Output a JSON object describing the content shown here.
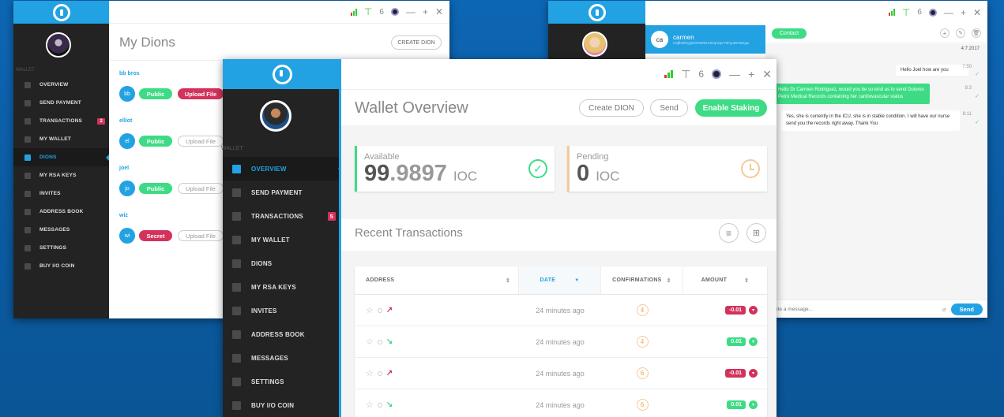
{
  "colors": {
    "brand": "#22a2e3",
    "green": "#3ddc84",
    "red": "#d3325b",
    "orange": "#f5a04a",
    "sidebar": "#232323"
  },
  "w1": {
    "title": "My Dions",
    "create_label": "CREATE DION",
    "section_label": "WALLET",
    "nav": [
      {
        "label": "OVERVIEW",
        "icon": "home-icon"
      },
      {
        "label": "SEND PAYMENT",
        "icon": "send-icon"
      },
      {
        "label": "TRANSACTIONS",
        "icon": "transfer-icon",
        "badge": "2"
      },
      {
        "label": "MY WALLET",
        "icon": "wallet-icon"
      },
      {
        "label": "DIONS",
        "icon": "folder-icon"
      },
      {
        "label": "MY RSA KEYS",
        "icon": "key-icon"
      },
      {
        "label": "INVITES",
        "icon": "invite-icon"
      },
      {
        "label": "ADDRESS BOOK",
        "icon": "star-icon"
      },
      {
        "label": "MESSAGES",
        "icon": "chat-icon"
      },
      {
        "label": "SETTINGS",
        "icon": "settings-icon"
      },
      {
        "label": "BUY I/O COIN",
        "icon": "coin-icon"
      }
    ],
    "dions": [
      {
        "name": "bb bros",
        "initials": "bb",
        "status": "Public",
        "action": "Upload File",
        "action_active": true
      },
      {
        "name": "elliot",
        "initials": "el",
        "status": "Public",
        "action": "Upload File",
        "action_active": false
      },
      {
        "name": "joel",
        "initials": "jo",
        "status": "Public",
        "action": "Upload File",
        "action_active": false
      },
      {
        "name": "wiz",
        "initials": "wi",
        "status": "Secret",
        "action": "Upload File",
        "action_active": false
      }
    ]
  },
  "w2": {
    "title": "Wallet Overview",
    "create_label": "Create DION",
    "send_label": "Send",
    "staking_label": "Enable Staking",
    "section_label": "WALLET",
    "nav": [
      {
        "label": "OVERVIEW",
        "icon": "home-icon"
      },
      {
        "label": "SEND PAYMENT",
        "icon": "send-icon"
      },
      {
        "label": "TRANSACTIONS",
        "icon": "transfer-icon",
        "badge": "5"
      },
      {
        "label": "MY WALLET",
        "icon": "wallet-icon"
      },
      {
        "label": "DIONS",
        "icon": "folder-icon"
      },
      {
        "label": "MY RSA KEYS",
        "icon": "key-icon"
      },
      {
        "label": "INVITES",
        "icon": "invite-icon"
      },
      {
        "label": "ADDRESS BOOK",
        "icon": "star-icon"
      },
      {
        "label": "MESSAGES",
        "icon": "chat-icon"
      },
      {
        "label": "SETTINGS",
        "icon": "settings-icon"
      },
      {
        "label": "BUY I/O COIN",
        "icon": "coin-icon"
      }
    ],
    "available": {
      "label": "Available",
      "int": "99",
      "dec": ".9897",
      "unit": "IOC"
    },
    "pending": {
      "label": "Pending",
      "int": "0",
      "unit": "IOC"
    },
    "recent_title": "Recent Transactions",
    "columns": [
      "ADDRESS",
      "DATE",
      "CONFIRMATIONS",
      "AMOUNT"
    ],
    "rows": [
      {
        "date": "24 minutes ago",
        "conf": "4",
        "amount": "-0.01",
        "dir": "out"
      },
      {
        "date": "24 minutes ago",
        "conf": "4",
        "amount": "0.01",
        "dir": "in"
      },
      {
        "date": "24 minutes ago",
        "conf": "6",
        "amount": "-0.01",
        "dir": "out"
      },
      {
        "date": "24 minutes ago",
        "conf": "6",
        "amount": "0.01",
        "dir": "in"
      }
    ]
  },
  "w3": {
    "contact_name": "carmen",
    "contact_initials": "ca",
    "contact_address": "mxjfbzbFgQtKhKDRKC53qrSqvY5FquDmWegw",
    "contact_label": "Contact",
    "date": "4:7:2017",
    "messages": [
      {
        "text": "Hello Joel how are you",
        "time": "7:50",
        "side": "right"
      },
      {
        "text": "Hello Dr Carmen Rodriguez, would you be so kind as to send Dolores Petro Medical Records containing her cardiovascular status",
        "time": "8:3",
        "side": "left-green"
      },
      {
        "text": "Yes, she is currently in the ICU, she is in stable condition. I will have our nurse send you the records right away. Thank You",
        "time": "8:11",
        "side": "right"
      }
    ],
    "input_placeholder": "Write a message...",
    "send_label": "Send"
  }
}
